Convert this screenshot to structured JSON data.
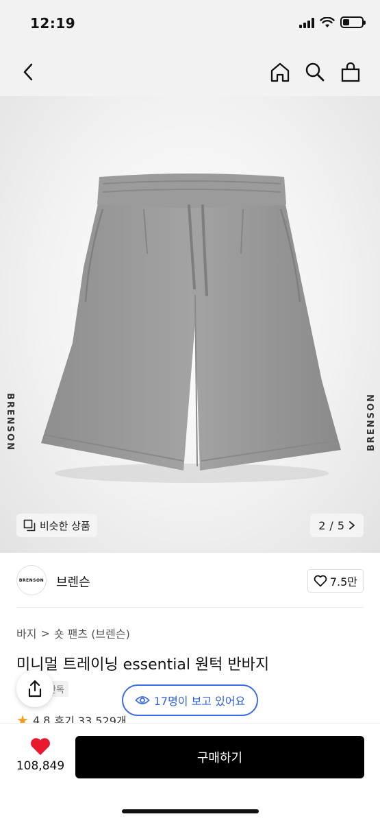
{
  "status_bar": {
    "time": "12:19",
    "battery_percent": 35
  },
  "nav": {
    "back_icon": "chevron-left-icon",
    "home_icon": "home-icon",
    "search_icon": "search-icon",
    "bag_icon": "shopping-bag-icon"
  },
  "hero": {
    "brand_watermark": "BRENSON",
    "similar_label": "비슷한 상품",
    "page_current": "2",
    "page_total": "5",
    "page_separator": "/"
  },
  "brand": {
    "logo_text": "BRENSON",
    "name": "브렌슨",
    "likes": "7.5만"
  },
  "breadcrumb": {
    "category": "바지",
    "separator": ">",
    "subcategory": "숏 팬츠 (브렌슨)"
  },
  "product": {
    "title": "미니멀 트레이닝 essential 원턱 반바지",
    "tag": "단독",
    "viewers": "17명이 보고 있어요",
    "rating": "4.8",
    "reviews": "후기 33,529개"
  },
  "bottom": {
    "wish_count": "108,849",
    "buy_label": "구매하기"
  },
  "colors": {
    "accent_blue": "#3d6ee8",
    "heart_red": "#e8192c",
    "star": "#f0a020",
    "buy_bg": "#000000"
  }
}
